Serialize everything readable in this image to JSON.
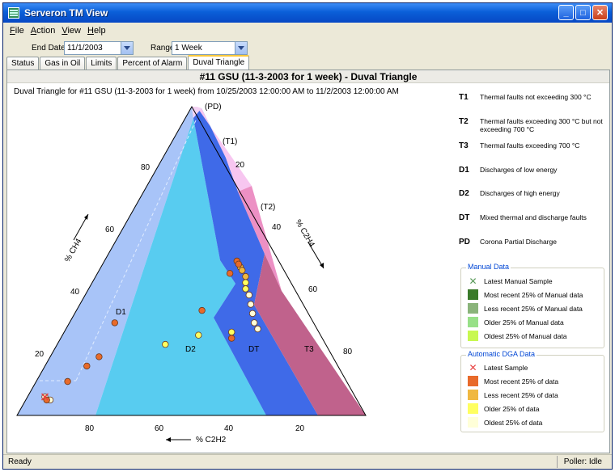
{
  "window": {
    "title": "Serveron TM View"
  },
  "menu": [
    {
      "label": "File",
      "key": "F",
      "rest": "ile"
    },
    {
      "label": "Action",
      "key": "A",
      "rest": "ction"
    },
    {
      "label": "View",
      "key": "V",
      "rest": "iew"
    },
    {
      "label": "Help",
      "key": "H",
      "rest": "elp"
    }
  ],
  "filters": {
    "end_date_label": "End Date",
    "end_date_value": "11/1/2003",
    "range_label": "Range",
    "range_value": "1 Week"
  },
  "tabs": [
    "Status",
    "Gas in Oil",
    "Limits",
    "Percent of Alarm",
    "Duval Triangle"
  ],
  "active_tab": "Duval Triangle",
  "header": {
    "title": "#11 GSU (11-3-2003 for 1 week) - Duval Triangle"
  },
  "subtitle": "Duval Triangle for #11 GSU (11-3-2003 for 1 week) from 10/25/2003 12:00:00 AM to 11/2/2003 12:00:00 AM",
  "chart_data": {
    "type": "scatter",
    "subtype": "duval-triangle",
    "axes": {
      "left": {
        "label": "% CH4",
        "ticks": [
          "20",
          "40",
          "60",
          "80"
        ]
      },
      "right": {
        "label": "% C2H4",
        "ticks": [
          "20",
          "40",
          "60",
          "80"
        ]
      },
      "bottom": {
        "label": "% C2H2",
        "ticks": [
          "80",
          "60",
          "40",
          "20"
        ]
      }
    },
    "zones": [
      {
        "code": "PD",
        "label": "(PD)",
        "color": "#f4d3f4"
      },
      {
        "code": "T1",
        "label": "(T1)",
        "color": "#f7c6f0"
      },
      {
        "code": "T2",
        "label": "(T2)",
        "color": "#ec90c4"
      },
      {
        "code": "T3",
        "label": "T3",
        "color": "#c0628c"
      },
      {
        "code": "DT",
        "label": "DT",
        "color": "#3f6ae8"
      },
      {
        "code": "D1",
        "label": "D1",
        "color": "#a8c4f8"
      },
      {
        "code": "D2",
        "label": "D2",
        "color": "#58ccf0"
      }
    ],
    "series": [
      {
        "name": "Most recent 25% of data",
        "color": "#e86a2a",
        "points": [
          {
            "ch4": 25,
            "c2h4": 49,
            "c2h2": 26
          },
          {
            "ch4": 30,
            "c2h4": 13,
            "c2h2": 57
          },
          {
            "ch4": 19,
            "c2h4": 14,
            "c2h2": 67
          },
          {
            "ch4": 16,
            "c2h4": 12,
            "c2h2": 72
          },
          {
            "ch4": 11,
            "c2h4": 9,
            "c2h2": 80
          },
          {
            "ch4": 5,
            "c2h4": 6,
            "c2h2": 89
          },
          {
            "ch4": 50,
            "c2h4": 38,
            "c2h2": 12
          },
          {
            "ch4": 49,
            "c2h4": 39,
            "c2h2": 12
          },
          {
            "ch4": 46,
            "c2h4": 38,
            "c2h2": 16
          },
          {
            "ch4": 34,
            "c2h4": 36,
            "c2h2": 30
          }
        ]
      },
      {
        "name": "Less recent 25% of data",
        "color": "#f0b840",
        "points": [
          {
            "ch4": 48,
            "c2h4": 40,
            "c2h2": 12
          },
          {
            "ch4": 47,
            "c2h4": 41,
            "c2h2": 12
          },
          {
            "ch4": 45,
            "c2h4": 43,
            "c2h2": 12
          }
        ]
      },
      {
        "name": "Older 25% of data",
        "color": "#ffff60",
        "points": [
          {
            "ch4": 43,
            "c2h4": 44,
            "c2h2": 13
          },
          {
            "ch4": 41,
            "c2h4": 45,
            "c2h2": 14
          },
          {
            "ch4": 27,
            "c2h4": 48,
            "c2h2": 25
          },
          {
            "ch4": 26,
            "c2h4": 39,
            "c2h2": 35
          },
          {
            "ch4": 23,
            "c2h4": 31,
            "c2h2": 46
          }
        ]
      },
      {
        "name": "Oldest 25% of data",
        "color": "#ffffd8",
        "points": [
          {
            "ch4": 39,
            "c2h4": 47,
            "c2h2": 14
          },
          {
            "ch4": 36,
            "c2h4": 49,
            "c2h2": 15
          },
          {
            "ch4": 33,
            "c2h4": 51,
            "c2h2": 16
          },
          {
            "ch4": 30,
            "c2h4": 53,
            "c2h2": 17
          },
          {
            "ch4": 28,
            "c2h4": 55,
            "c2h2": 17
          },
          {
            "ch4": 5,
            "c2h4": 7,
            "c2h2": 88
          },
          {
            "ch4": 6,
            "c2h4": 5,
            "c2h2": 89
          }
        ]
      }
    ],
    "latest_sample": {
      "ch4": 6,
      "c2h4": 5,
      "c2h2": 89,
      "color": "#e84040"
    }
  },
  "legend": [
    {
      "code": "T1",
      "desc": "Thermal faults not exceeding 300 °C"
    },
    {
      "code": "T2",
      "desc": "Thermal faults exceeding 300 °C but not exceeding 700 °C"
    },
    {
      "code": "T3",
      "desc": "Thermal faults exceeding 700 °C"
    },
    {
      "code": "D1",
      "desc": "Discharges of low energy"
    },
    {
      "code": "D2",
      "desc": "Discharges of high energy"
    },
    {
      "code": "DT",
      "desc": "Mixed thermal and discharge faults"
    },
    {
      "code": "PD",
      "desc": "Corona Partial Discharge"
    }
  ],
  "manual_data": {
    "title": "Manual Data",
    "items": [
      {
        "label": "Latest Manual Sample",
        "kind": "x",
        "color": "#5a9a5a"
      },
      {
        "label": "Most recent 25% of Manual data",
        "kind": "swatch",
        "color": "#3a7a2a"
      },
      {
        "label": "Less recent 25% of Manual data",
        "kind": "swatch",
        "color": "#8ab47a"
      },
      {
        "label": "Older 25% of Manual data",
        "kind": "swatch",
        "color": "#98e088"
      },
      {
        "label": "Oldest 25% of Manual data",
        "kind": "swatch",
        "color": "#c8f850"
      }
    ]
  },
  "auto_data": {
    "title": "Automatic DGA Data",
    "items": [
      {
        "label": "Latest Sample",
        "kind": "x",
        "color": "#e84040"
      },
      {
        "label": "Most recent 25% of data",
        "kind": "swatch",
        "color": "#e86a2a"
      },
      {
        "label": "Less recent 25% of data",
        "kind": "swatch",
        "color": "#f0b840"
      },
      {
        "label": "Older 25% of data",
        "kind": "swatch",
        "color": "#ffff60"
      },
      {
        "label": "Oldest 25% of data",
        "kind": "swatch",
        "color": "#ffffd8"
      }
    ]
  },
  "status": {
    "left": "Ready",
    "right": "Poller: Idle"
  }
}
